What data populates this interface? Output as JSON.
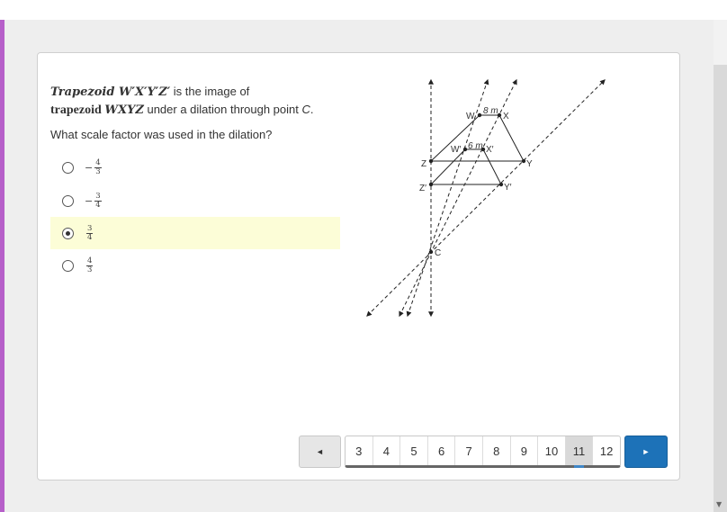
{
  "prompt": {
    "line1_math": "Trapezoid W′X′Y′Z′",
    "line1_text": " is the image of",
    "line2_word": "trapezoid",
    "line2_math": "WXYZ",
    "line2_text": " under a dilation through point ",
    "line2_point": "C",
    "line2_end": "."
  },
  "question": "What scale factor was used in the dilation?",
  "choices": [
    {
      "sign": "−",
      "numerator": "4",
      "denominator": "3",
      "selected": false
    },
    {
      "sign": "−",
      "numerator": "3",
      "denominator": "4",
      "selected": false
    },
    {
      "sign": "",
      "numerator": "3",
      "denominator": "4",
      "selected": true
    },
    {
      "sign": "",
      "numerator": "4",
      "denominator": "3",
      "selected": false
    }
  ],
  "figure": {
    "labels": {
      "W": "W",
      "X": "X",
      "Y": "Y",
      "Z": "Z",
      "Wp": "W′",
      "Xp": "X′",
      "Yp": "Y′",
      "Zp": "Z′",
      "C": "C",
      "top_length": "8 m",
      "image_length": "6 m"
    }
  },
  "pager": {
    "prev_icon": "◄",
    "next_icon": "►",
    "pages": [
      "3",
      "4",
      "5",
      "6",
      "7",
      "8",
      "9",
      "10",
      "11",
      "12"
    ],
    "current": "11"
  },
  "colors": {
    "accent": "#b65fc9",
    "selected_bg": "#fcfdd7",
    "next_button": "#1d72b8",
    "current_page_indicator": "#3f87c8"
  }
}
